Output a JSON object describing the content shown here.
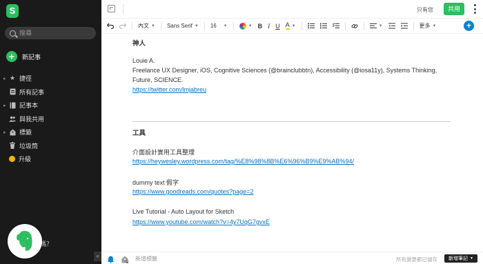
{
  "sidebar": {
    "logo_letter": "S",
    "search_placeholder": "搜尋",
    "new_note_label": "新記事",
    "items": [
      {
        "label": "捷徑",
        "icon": "star-icon",
        "has_arrow": true
      },
      {
        "label": "所有記事",
        "icon": "note-icon",
        "has_arrow": false
      },
      {
        "label": "記事本",
        "icon": "notebook-icon",
        "has_arrow": true
      },
      {
        "label": "與我共用",
        "icon": "people-icon",
        "has_arrow": false
      },
      {
        "label": "標籤",
        "icon": "tag-icon",
        "has_arrow": true
      },
      {
        "label": "垃圾筒",
        "icon": "trash-icon",
        "has_arrow": false
      },
      {
        "label": "升級",
        "icon": "upgrade-icon",
        "has_arrow": false
      }
    ],
    "help_text": "嗎？",
    "collapse_glyph": "«"
  },
  "header": {
    "visibility_label": "只有您",
    "share_label": "共用"
  },
  "toolbar": {
    "font_style": "內文",
    "font_family": "Sans Serif",
    "font_size": "16",
    "bold": "B",
    "italic": "I",
    "underline": "U",
    "highlight": "A",
    "more_label": "更多",
    "colors": {
      "accent": "#0083d2",
      "brand": "#2dbe60"
    }
  },
  "note": {
    "section1_title": "神人",
    "person_name": "Louie A.",
    "person_desc_line1": "Freelance UX Designer, iOS, Cognitive Sciences (@brainclubbtn), Accessibility (@iosa11y), Systems Thinking,",
    "person_desc_line2": "Future, SCIENCE.",
    "person_link": "https://twitter.com/lmjabreu",
    "section2_title": "工具",
    "tool1_title": "介面設計實用工具整理",
    "tool1_link": "https://heywesley.wordpress.com/tag/%E8%98%8B%E6%96%B9%E9%AB%94/",
    "tool2_title": "dummy text 假字",
    "tool2_link": "https://www.goodreads.com/quotes?page=2",
    "tool3_title": "Live Tutorial - Auto Layout for Sketch",
    "tool3_link": "https://www.youtube.com/watch?v=4y7UqG7gvxE"
  },
  "footer": {
    "tag_placeholder": "新增標籤",
    "saved_status": "所有變更都已儲存",
    "new_note_button": "新增筆記"
  }
}
